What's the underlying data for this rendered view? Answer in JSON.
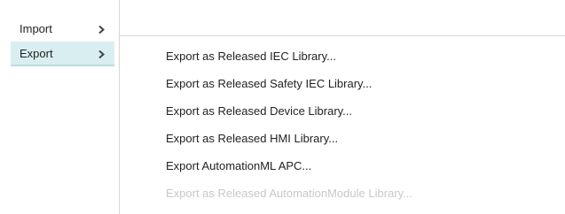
{
  "parent_menu": {
    "items": [
      {
        "label": "Import",
        "selected": false,
        "icon": "chevron-right-icon"
      },
      {
        "label": "Export",
        "selected": true,
        "icon": "chevron-right-icon"
      }
    ]
  },
  "submenu": {
    "items": [
      {
        "label": "Export as Released IEC Library...",
        "enabled": true
      },
      {
        "label": "Export as Released Safety IEC Library...",
        "enabled": true
      },
      {
        "label": "Export as Released Device Library...",
        "enabled": true
      },
      {
        "label": "Export as Released HMI Library...",
        "enabled": true
      },
      {
        "label": "Export AutomationML APC...",
        "enabled": true
      },
      {
        "label": "Export as Released AutomationModule Library...",
        "enabled": false
      }
    ]
  },
  "colors": {
    "selected_background": "#d9eef0",
    "selected_underline": "#b9dbe0",
    "text": "#222222",
    "disabled_text": "#c8c8c8",
    "divider": "#d6d6d6"
  }
}
